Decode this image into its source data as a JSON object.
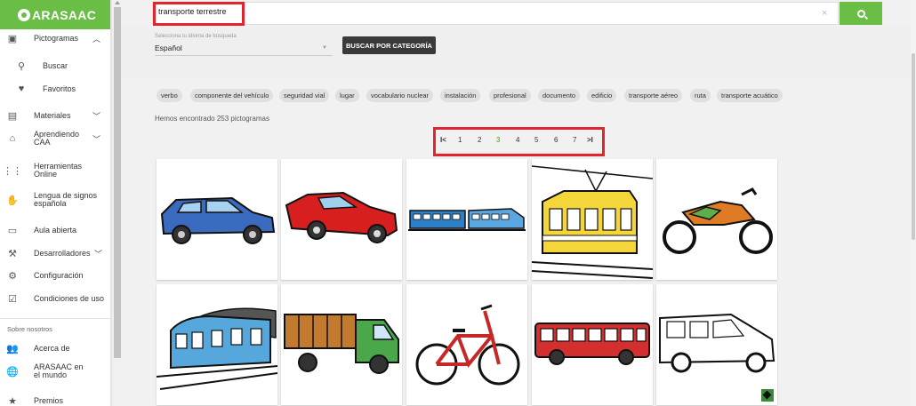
{
  "brand": {
    "name": "ARASAAC"
  },
  "sidebar": {
    "items": [
      {
        "label": "Pictogramas",
        "icon": "image-icon",
        "has_chevron": true,
        "chevron": "up"
      },
      {
        "label": "Buscar",
        "icon": "search-icon",
        "sub": true
      },
      {
        "label": "Favoritos",
        "icon": "heart-icon",
        "sub": true
      },
      {
        "label": "Materiales",
        "icon": "book-icon",
        "has_chevron": true,
        "chevron": "down"
      },
      {
        "label": "Aprendiendo CAA",
        "icon": "school-icon",
        "has_chevron": true,
        "chevron": "down"
      },
      {
        "label": "Herramientas Online",
        "icon": "apps-grid-icon"
      },
      {
        "label": "Lengua de signos española",
        "icon": "hand-icon"
      },
      {
        "label": "Aula abierta",
        "icon": "screen-icon"
      },
      {
        "label": "Desarrolladores",
        "icon": "wrench-icon",
        "has_chevron": true,
        "chevron": "down"
      },
      {
        "label": "Configuración",
        "icon": "gear-icon"
      },
      {
        "label": "Condiciones de uso",
        "icon": "checkbox-icon"
      }
    ],
    "section_label": "Sobre nosotros",
    "about_items": [
      {
        "label": "Acerca de",
        "icon": "people-icon"
      },
      {
        "label": "ARASAAC en el mundo",
        "icon": "globe-icon"
      },
      {
        "label": "Premios",
        "icon": "award-icon"
      }
    ]
  },
  "search": {
    "value": "transporte terrestre",
    "clear_glyph": "×"
  },
  "language": {
    "caption": "Selecciona tu idioma de búsqueda",
    "selected": "Español"
  },
  "category_button": "BUSCAR POR CATEGORÍA",
  "chips": [
    "verbo",
    "componente del vehículo",
    "seguridad vial",
    "lugar",
    "vocabulario nuclear",
    "instalación",
    "profesional",
    "documento",
    "edificio",
    "transporte aéreo",
    "ruta",
    "transporte acuático"
  ],
  "results": {
    "count_text": "Hemos encontrado 253 pictogramas"
  },
  "pagination": {
    "first_glyph": "I<",
    "last_glyph": ">I",
    "pages": [
      "1",
      "2",
      "3",
      "4",
      "5",
      "6",
      "7"
    ],
    "active": "3"
  },
  "pictograms": [
    {
      "name": "car-pictogram",
      "color": "#3b6bbf"
    },
    {
      "name": "sports-car-pictogram",
      "color": "#d71f1f"
    },
    {
      "name": "train-pictogram",
      "color": "#2f7fc6"
    },
    {
      "name": "tram-pictogram",
      "color": "#f4d63a"
    },
    {
      "name": "motorcycle-pictogram",
      "color": "#e07b25"
    },
    {
      "name": "metro-pictogram",
      "color": "#56a8dc"
    },
    {
      "name": "truck-pictogram",
      "color": "#4aa84a"
    },
    {
      "name": "bicycle-pictogram",
      "color": "#c62828"
    },
    {
      "name": "bus-pictogram",
      "color": "#d32f2f"
    },
    {
      "name": "van-pictogram",
      "color": "#ffffff"
    }
  ],
  "colors": {
    "accent": "#6abe45",
    "highlight": "#e2242f",
    "dark_button": "#3a3a3a"
  }
}
